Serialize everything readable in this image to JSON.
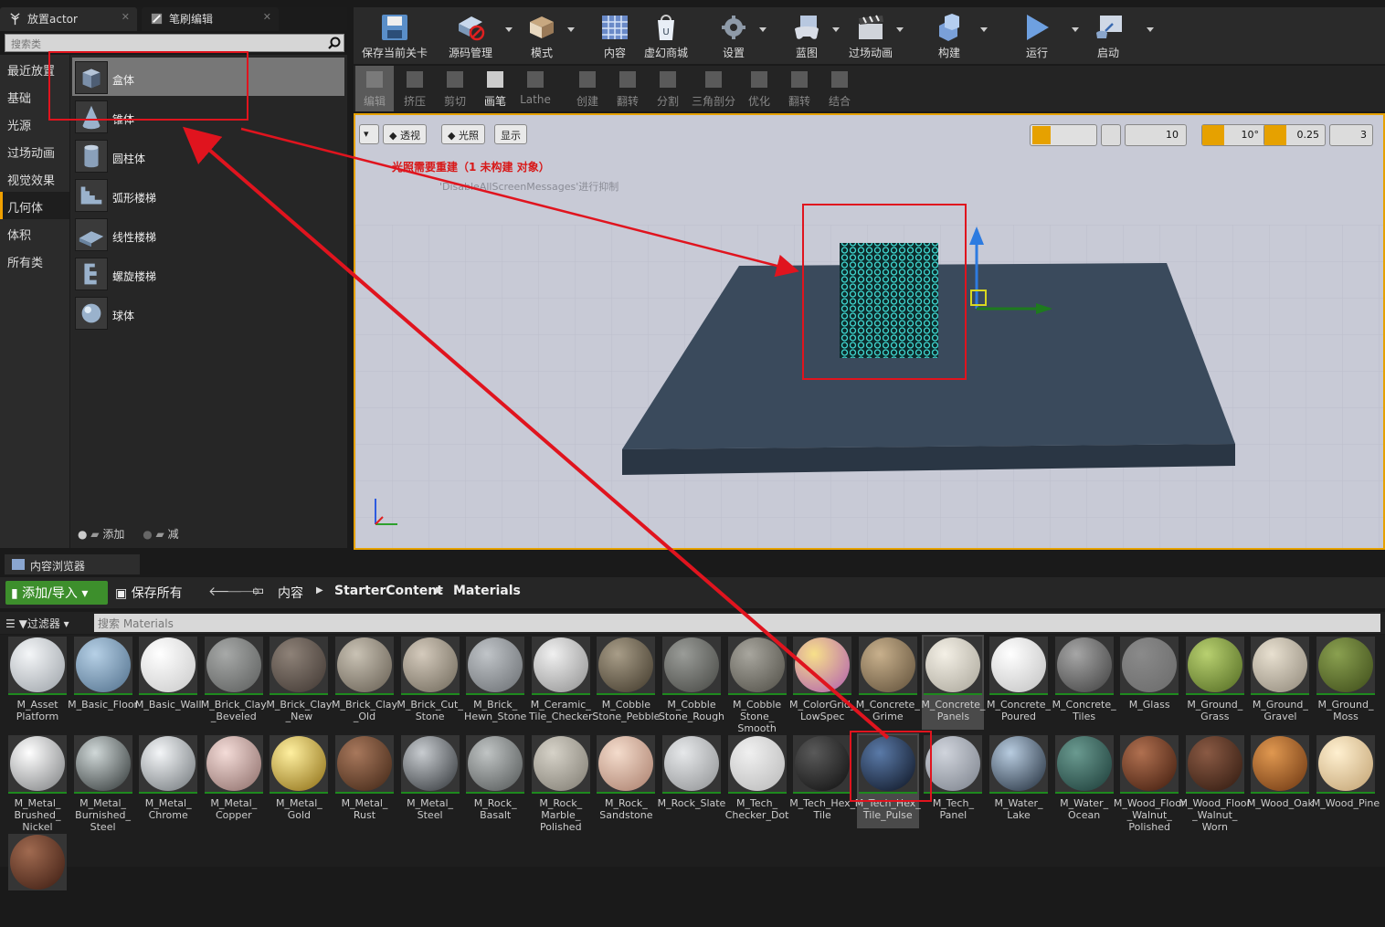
{
  "tabs": {
    "place_actor": "放置actor",
    "brush_edit": "笔刷编辑"
  },
  "search_classes_placeholder": "搜索类",
  "categories": [
    "最近放置",
    "基础",
    "光源",
    "过场动画",
    "视觉效果",
    "几何体",
    "体积",
    "所有类"
  ],
  "geometry": [
    "盒体",
    "锥体",
    "圆柱体",
    "弧形楼梯",
    "线性楼梯",
    "螺旋楼梯",
    "球体"
  ],
  "add_label": "添加",
  "subtract_label": "减",
  "toolbar": [
    "保存当前关卡",
    "源码管理",
    "模式",
    "内容",
    "虚幻商城",
    "设置",
    "蓝图",
    "过场动画",
    "构建",
    "运行",
    "启动"
  ],
  "modes": [
    "编辑",
    "挤压",
    "剪切",
    "画笔",
    "Lathe",
    "创建",
    "翻转",
    "分割",
    "三角剖分",
    "优化",
    "翻转",
    "结合"
  ],
  "viewport": {
    "perspective": "透视",
    "lit": "光照",
    "show": "显示",
    "warning": "光照需要重建（1 未构建 对象）",
    "suppress_msg": "'DisableAllScreenMessages'进行抑制",
    "grid_snap": "10",
    "rot_snap": "10°",
    "scale_snap": "0.25",
    "cam_speed": "3"
  },
  "content_browser": {
    "tab": "内容浏览器",
    "add_import": "添加/导入",
    "save_all": "保存所有",
    "path": [
      "内容",
      "StarterContent",
      "Materials"
    ],
    "filter": "过滤器",
    "search_placeholder": "搜索 Materials"
  },
  "assets_row1": [
    {
      "name": "M_Asset\nPlatform",
      "c1": "#f4f6f8",
      "c2": "#9aa0a6"
    },
    {
      "name": "M_Basic_Floor",
      "c1": "#b6d0e6",
      "c2": "#4f6e8a"
    },
    {
      "name": "M_Basic_Wall",
      "c1": "#ffffff",
      "c2": "#c8c8c8"
    },
    {
      "name": "M_Brick_Clay\n_Beveled",
      "c1": "#a7a9a8",
      "c2": "#5a5c5b"
    },
    {
      "name": "M_Brick_Clay\n_New",
      "c1": "#8e8278",
      "c2": "#3e3530"
    },
    {
      "name": "M_Brick_Clay\n_Old",
      "c1": "#c9c2b4",
      "c2": "#645c50"
    },
    {
      "name": "M_Brick_Cut_\nStone",
      "c1": "#d4cabc",
      "c2": "#6d6658"
    },
    {
      "name": "M_Brick_\nHewn_Stone",
      "c1": "#c0c4c8",
      "c2": "#686c70"
    },
    {
      "name": "M_Ceramic_\nTile_Checker",
      "c1": "#f0f0f0",
      "c2": "#8e8e8e"
    },
    {
      "name": "M_Cobble\nStone_Pebble",
      "c1": "#a89d88",
      "c2": "#3e3628"
    },
    {
      "name": "M_Cobble\nStone_Rough",
      "c1": "#9a9c98",
      "c2": "#454642"
    },
    {
      "name": "M_Cobble\nStone_\nSmooth",
      "c1": "#a8a69e",
      "c2": "#4e4c44"
    },
    {
      "name": "M_ColorGrid_\nLowSpec",
      "c1": "#f7e08a",
      "c2": "#b05cb0"
    },
    {
      "name": "M_Concrete_\nGrime",
      "c1": "#c8b08c",
      "c2": "#5e4e38"
    },
    {
      "name": "M_Concrete_\nPanels",
      "c1": "#f4f0e6",
      "c2": "#a8a498"
    },
    {
      "name": "M_Concrete_\nPoured",
      "c1": "#ffffff",
      "c2": "#c0c0c0"
    },
    {
      "name": "M_Concrete_\nTiles",
      "c1": "#a6a6a6",
      "c2": "#3e3e3e"
    },
    {
      "name": "M_Glass",
      "c1": "#8a8a8a",
      "c2": "#6a6a6a"
    },
    {
      "name": "M_Ground_\nGrass",
      "c1": "#b8d070",
      "c2": "#506820"
    },
    {
      "name": "M_Ground_\nGravel",
      "c1": "#e8e0d0",
      "c2": "#8e8678"
    },
    {
      "name": "M_Ground_\nMoss",
      "c1": "#8aa050",
      "c2": "#3c4a18"
    }
  ],
  "assets_row2": [
    {
      "name": "M_Metal_\nBrushed_\nNickel",
      "c1": "#ffffff",
      "c2": "#7a7c7e"
    },
    {
      "name": "M_Metal_\nBurnished_\nSteel",
      "c1": "#d0d8d8",
      "c2": "#2e3434"
    },
    {
      "name": "M_Metal_\nChrome",
      "c1": "#f4f6f8",
      "c2": "#6e7478"
    },
    {
      "name": "M_Metal_\nCopper",
      "c1": "#f4dcd8",
      "c2": "#8a6a66"
    },
    {
      "name": "M_Metal_\nGold",
      "c1": "#fff0a0",
      "c2": "#8a6a10"
    },
    {
      "name": "M_Metal_\nRust",
      "c1": "#a8785c",
      "c2": "#3e2414"
    },
    {
      "name": "M_Metal_\nSteel",
      "c1": "#c8ccd0",
      "c2": "#2e3236"
    },
    {
      "name": "M_Rock_\nBasalt",
      "c1": "#c0c4c4",
      "c2": "#505454"
    },
    {
      "name": "M_Rock_\nMarble_\nPolished",
      "c1": "#d6d2c8",
      "c2": "#7e7a70"
    },
    {
      "name": "M_Rock_\nSandstone",
      "c1": "#f4dccc",
      "c2": "#a87c6a"
    },
    {
      "name": "M_Rock_Slate",
      "c1": "#e6e8ea",
      "c2": "#8e9092"
    },
    {
      "name": "M_Tech_\nChecker_Dot",
      "c1": "#f0f0f0",
      "c2": "#b8b8b8"
    },
    {
      "name": "M_Tech_Hex_\nTile",
      "c1": "#5a5a5a",
      "c2": "#0e0e0e"
    },
    {
      "name": "M_Tech_Hex_\nTile_Pulse",
      "c1": "#5a7aa8",
      "c2": "#0c1220"
    },
    {
      "name": "M_Tech_\nPanel",
      "c1": "#d0d4dc",
      "c2": "#7a808a"
    },
    {
      "name": "M_Water_\nLake",
      "c1": "#b8cce0",
      "c2": "#1e2a38"
    },
    {
      "name": "M_Water_\nOcean",
      "c1": "#6a9a90",
      "c2": "#1a3a36"
    },
    {
      "name": "M_Wood_Floor\n_Walnut_\nPolished",
      "c1": "#b07050",
      "c2": "#3e1a0c"
    },
    {
      "name": "M_Wood_Floor\n_Walnut_\nWorn",
      "c1": "#8a5a44",
      "c2": "#2e180e"
    },
    {
      "name": "M_Wood_Oak",
      "c1": "#e09850",
      "c2": "#6a3410"
    },
    {
      "name": "M_Wood_Pine",
      "c1": "#fff0d0",
      "c2": "#c0a070"
    }
  ],
  "colors": {
    "accent": "#e6a100",
    "annotation": "#e0141e",
    "add_green": "#3d8f2c",
    "hex_cyan": "#3fd6cf"
  }
}
